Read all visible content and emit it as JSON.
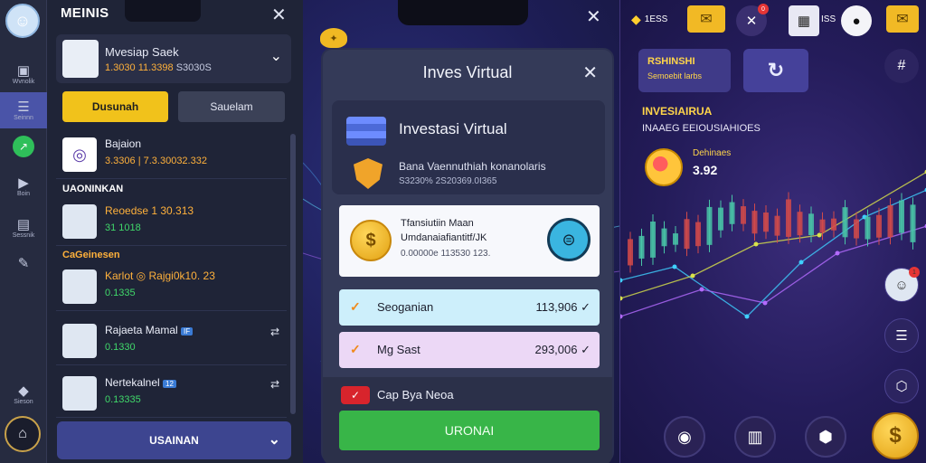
{
  "left": {
    "title": "MEINIS",
    "rail": [
      {
        "icon": "dashboard-icon",
        "glyph": "▣",
        "label": "Wvnolik"
      },
      {
        "icon": "document-icon",
        "glyph": "☰",
        "label": "Seinnn"
      },
      {
        "icon": "chart-icon",
        "glyph": "↗",
        "label": ""
      },
      {
        "icon": "play-icon",
        "glyph": "▶",
        "label": "Boin"
      },
      {
        "icon": "message-icon",
        "glyph": "▤",
        "label": "Sessnik"
      },
      {
        "icon": "settings-icon",
        "glyph": "✎",
        "label": ""
      },
      {
        "icon": "diamond-icon",
        "glyph": "◆",
        "label": "Sieson"
      }
    ],
    "profile": {
      "name": "Mvesiap Saek",
      "num1": "1.3030 11.3398",
      "num2": "S3030S"
    },
    "tab_primary": "Dusunah",
    "tab_secondary": "Sauelam",
    "list1": {
      "title": "Bajaion",
      "value": "3.3306 | 7.3.30032.332"
    },
    "section1": "UAONINKAN",
    "list2": {
      "title": "Reoedse 1 30.313",
      "value": "31 1018"
    },
    "section2": "CaGeinesen",
    "list3": {
      "title": "Karlot ◎ Rajgi0k10. 23",
      "value": "0.1335"
    },
    "list4": {
      "title": "Rajaeta Mamal",
      "value": "0.1330",
      "badge": "IF"
    },
    "list5": {
      "title": "Nertekalnel",
      "value": "0.13335",
      "badge": "12"
    },
    "bottom_button": "USAINAN"
  },
  "mid": {
    "dialog_title": "Inves Virtual",
    "card_title": "Investasi Virtual",
    "card_sub1": "Bana Vaennuthiah konanolaris",
    "card_sub2": "S3230% 2S20369.0I365",
    "info_line1": "Tfansiutiin Maan",
    "info_line2": "Umdanaiafiantitf/JK",
    "info_line3": "0.00000e 113530 123.",
    "row1": {
      "label": "Seoganian",
      "value": "113,906"
    },
    "row2": {
      "label": "Mg Sast",
      "value": "293,006"
    },
    "checkbox_label": "Cap Bya Neoa",
    "action_button": "URONAI"
  },
  "right": {
    "logo_text": "1ESS",
    "badge_count": "0",
    "label_text": "ISS",
    "card_a_title": "RSHINSHI",
    "card_a_sub": "Semoebit larbs",
    "heading": "INVESIAIRUA",
    "subheading": "INAAEG EEIOUSIAHIOES",
    "balance_label": "Dehinaes",
    "balance_value": "3.92",
    "notif_count": "1"
  },
  "colors": {
    "accent_yellow": "#f1c21b",
    "accent_green": "#38b548",
    "panel_dark": "#1f2437"
  }
}
